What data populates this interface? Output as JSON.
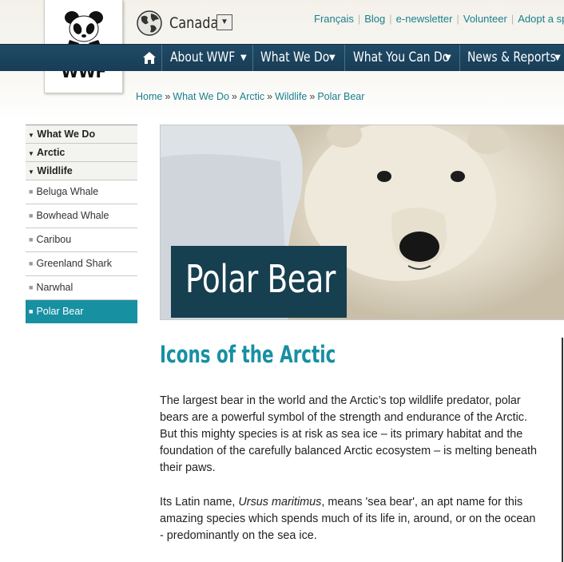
{
  "site": {
    "logo_text": "WWF",
    "country": "Canada",
    "top_links": [
      "Français",
      "Blog",
      "e-newsletter",
      "Volunteer",
      "Adopt a sp"
    ]
  },
  "nav": {
    "items": [
      "About WWF",
      "What We Do",
      "What You Can Do",
      "News & Reports"
    ]
  },
  "breadcrumb": [
    "Home",
    "What We Do",
    "Arctic",
    "Wildlife",
    "Polar Bear"
  ],
  "sidebar": {
    "headers": [
      "What We Do",
      "Arctic",
      "Wildlife"
    ],
    "items": [
      "Beluga Whale",
      "Bowhead Whale",
      "Caribou",
      "Greenland Shark",
      "Narwhal",
      "Polar Bear"
    ],
    "active_item": "Polar Bear"
  },
  "hero": {
    "title": "Polar Bear"
  },
  "article": {
    "heading": "Icons of the Arctic",
    "p1": "The largest bear in the world and the Arctic’s top wildlife predator, polar bears are a powerful symbol of the strength and endurance of the Arctic. But this mighty species is at risk as sea ice – its primary habitat and the foundation of the carefully balanced Arctic ecosystem – is melting beneath their paws.",
    "p2_before": "Its Latin name, ",
    "p2_latin": "Ursus maritimus",
    "p2_after": ", means 'sea bear', an apt name for this amazing species which spends much of its life in, around, or on the ocean - predominantly on the sea ice."
  },
  "colors": {
    "nav_bg": "#1f4a66",
    "accent_teal": "#1790a2",
    "hero_label_bg": "#163f50"
  }
}
